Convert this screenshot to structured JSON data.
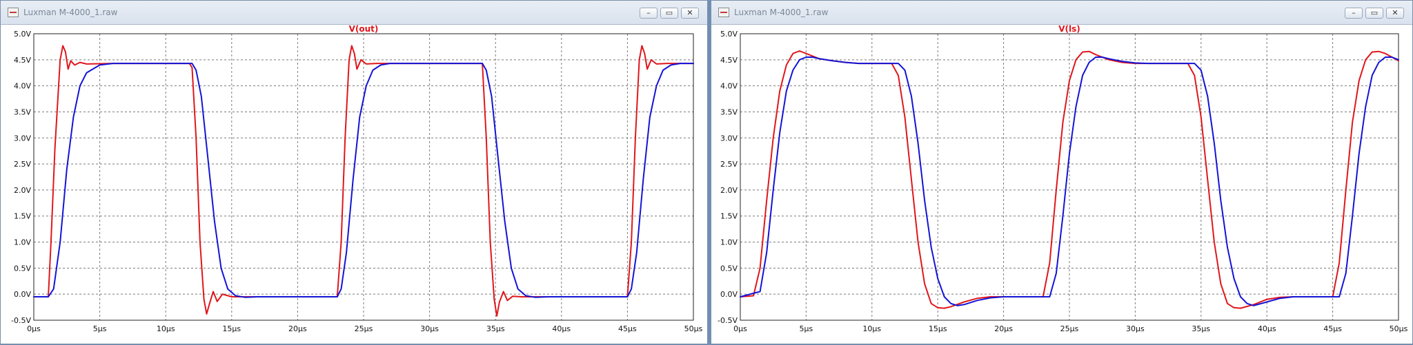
{
  "windows": [
    {
      "title": "Luxman M-4000_1.raw",
      "controls": {
        "minimize": "–",
        "restore": "▭",
        "close": "✕"
      },
      "chart_data": {
        "type": "line",
        "title": "V(out)",
        "title_color": "#e0161b",
        "xlim": [
          0,
          50
        ],
        "ylim": [
          -0.5,
          5.0
        ],
        "x_ticks": [
          "0µs",
          "5µs",
          "10µs",
          "15µs",
          "20µs",
          "25µs",
          "30µs",
          "35µs",
          "40µs",
          "45µs",
          "50µs"
        ],
        "y_ticks": [
          "5.0V",
          "4.5V",
          "4.0V",
          "3.5V",
          "3.0V",
          "2.5V",
          "2.0V",
          "1.5V",
          "1.0V",
          "0.5V",
          "0.0V",
          "-0.5V"
        ],
        "grid": true,
        "series": [
          {
            "color": "#e0161b",
            "x": [
              0,
              1.1,
              1.3,
              1.6,
              2.0,
              2.2,
              2.4,
              2.6,
              2.8,
              3.1,
              3.5,
              4.0,
              6.0,
              11.8,
              12.0,
              12.3,
              12.6,
              12.9,
              13.1,
              13.3,
              13.6,
              13.9,
              14.3,
              15.0,
              23.0,
              23.3,
              23.6,
              23.9,
              24.1,
              24.3,
              24.5,
              24.8,
              25.2,
              26.0,
              34.0,
              34.3,
              34.6,
              34.9,
              35.1,
              35.3,
              35.6,
              35.9,
              36.3,
              37.0,
              45.0,
              45.3,
              45.6,
              45.9,
              46.1,
              46.3,
              46.5,
              46.8,
              47.2,
              48.0,
              50.0
            ],
            "y": [
              -0.05,
              -0.05,
              1.0,
              2.8,
              4.5,
              4.77,
              4.65,
              4.32,
              4.48,
              4.4,
              4.45,
              4.42,
              4.43,
              4.43,
              4.35,
              3.0,
              1.0,
              -0.1,
              -0.38,
              -0.2,
              0.05,
              -0.14,
              0.0,
              -0.05,
              -0.05,
              1.0,
              3.0,
              4.5,
              4.77,
              4.62,
              4.32,
              4.5,
              4.42,
              4.43,
              4.43,
              3.0,
              1.0,
              -0.1,
              -0.42,
              -0.15,
              0.05,
              -0.12,
              -0.04,
              -0.05,
              -0.05,
              1.0,
              3.0,
              4.5,
              4.77,
              4.62,
              4.32,
              4.5,
              4.42,
              4.43,
              4.43
            ]
          },
          {
            "color": "#1313d6",
            "x": [
              0,
              1.1,
              1.5,
              2.0,
              2.5,
              3.0,
              3.5,
              4.0,
              5.0,
              6.0,
              12.0,
              12.3,
              12.7,
              13.2,
              13.7,
              14.2,
              14.7,
              15.3,
              16.0,
              17.0,
              23.0,
              23.3,
              23.7,
              24.2,
              24.7,
              25.2,
              25.7,
              26.3,
              27.0,
              28.0,
              34.0,
              34.3,
              34.7,
              35.2,
              35.7,
              36.2,
              36.7,
              37.3,
              38.0,
              39.0,
              45.0,
              45.3,
              45.7,
              46.2,
              46.7,
              47.2,
              47.7,
              48.3,
              49.0,
              50.0
            ],
            "y": [
              -0.05,
              -0.05,
              0.1,
              1.0,
              2.4,
              3.4,
              4.0,
              4.25,
              4.4,
              4.43,
              4.43,
              4.3,
              3.8,
              2.6,
              1.4,
              0.5,
              0.1,
              -0.03,
              -0.06,
              -0.05,
              -0.05,
              0.1,
              0.8,
              2.2,
              3.4,
              4.0,
              4.3,
              4.4,
              4.43,
              4.43,
              4.43,
              4.3,
              3.8,
              2.6,
              1.4,
              0.5,
              0.1,
              -0.03,
              -0.06,
              -0.05,
              -0.05,
              0.1,
              0.8,
              2.2,
              3.4,
              4.0,
              4.3,
              4.4,
              4.43,
              4.43
            ]
          }
        ]
      }
    },
    {
      "title": "Luxman M-4000_1.raw",
      "controls": {
        "minimize": "–",
        "restore": "▭",
        "close": "✕"
      },
      "chart_data": {
        "type": "line",
        "title": "V(ls)",
        "title_color": "#e0161b",
        "xlim": [
          0,
          50
        ],
        "ylim": [
          -0.5,
          5.0
        ],
        "x_ticks": [
          "0µs",
          "5µs",
          "10µs",
          "15µs",
          "20µs",
          "25µs",
          "30µs",
          "35µs",
          "40µs",
          "45µs",
          "50µs"
        ],
        "y_ticks": [
          "5.0V",
          "4.5V",
          "4.0V",
          "3.5V",
          "3.0V",
          "2.5V",
          "2.0V",
          "1.5V",
          "1.0V",
          "0.5V",
          "0.0V",
          "-0.5V"
        ],
        "grid": true,
        "series": [
          {
            "color": "#e0161b",
            "x": [
              0,
              1.0,
              1.5,
              2.0,
              2.5,
              3.0,
              3.5,
              4.0,
              4.5,
              5.0,
              6.0,
              7.0,
              8.0,
              9.0,
              11.5,
              12.0,
              12.5,
              13.0,
              13.5,
              14.0,
              14.5,
              15.0,
              15.5,
              16.0,
              17.0,
              18.0,
              19.0,
              20.0,
              23.0,
              23.5,
              24.0,
              24.5,
              25.0,
              25.5,
              26.0,
              26.5,
              27.0,
              28.0,
              29.0,
              30.0,
              31.0,
              34.0,
              34.5,
              35.0,
              35.5,
              36.0,
              36.5,
              37.0,
              37.5,
              38.0,
              39.0,
              40.0,
              41.0,
              42.0,
              45.0,
              45.5,
              46.0,
              46.5,
              47.0,
              47.5,
              48.0,
              48.5,
              49.0,
              49.5,
              50.0
            ],
            "y": [
              -0.05,
              -0.03,
              0.5,
              1.8,
              3.0,
              3.9,
              4.4,
              4.62,
              4.67,
              4.62,
              4.52,
              4.48,
              4.45,
              4.43,
              4.43,
              4.2,
              3.4,
              2.2,
              1.0,
              0.2,
              -0.18,
              -0.26,
              -0.27,
              -0.24,
              -0.15,
              -0.08,
              -0.05,
              -0.05,
              -0.05,
              0.6,
              2.0,
              3.3,
              4.1,
              4.5,
              4.65,
              4.66,
              4.6,
              4.5,
              4.45,
              4.43,
              4.43,
              4.43,
              4.2,
              3.4,
              2.2,
              1.0,
              0.2,
              -0.18,
              -0.26,
              -0.27,
              -0.2,
              -0.1,
              -0.06,
              -0.05,
              -0.05,
              0.6,
              2.0,
              3.3,
              4.1,
              4.5,
              4.65,
              4.66,
              4.62,
              4.55,
              4.48
            ]
          },
          {
            "color": "#1313d6",
            "x": [
              0,
              1.5,
              2.0,
              2.5,
              3.0,
              3.5,
              4.0,
              4.5,
              5.0,
              5.5,
              6.0,
              7.0,
              8.0,
              9.0,
              10.0,
              12.0,
              12.5,
              13.0,
              13.5,
              14.0,
              14.5,
              15.0,
              15.5,
              16.0,
              16.5,
              17.0,
              18.0,
              19.0,
              20.0,
              23.5,
              24.0,
              24.5,
              25.0,
              25.5,
              26.0,
              26.5,
              27.0,
              27.5,
              28.0,
              29.0,
              30.0,
              31.0,
              34.5,
              35.0,
              35.5,
              36.0,
              36.5,
              37.0,
              37.5,
              38.0,
              38.5,
              39.0,
              40.0,
              41.0,
              42.0,
              45.5,
              46.0,
              46.5,
              47.0,
              47.5,
              48.0,
              48.5,
              49.0,
              49.5,
              50.0
            ],
            "y": [
              -0.05,
              0.05,
              0.8,
              2.0,
              3.1,
              3.9,
              4.3,
              4.5,
              4.55,
              4.55,
              4.52,
              4.48,
              4.45,
              4.43,
              4.43,
              4.43,
              4.3,
              3.8,
              2.9,
              1.8,
              0.9,
              0.3,
              -0.05,
              -0.18,
              -0.22,
              -0.2,
              -0.12,
              -0.07,
              -0.05,
              -0.05,
              0.4,
              1.5,
              2.7,
              3.6,
              4.2,
              4.45,
              4.55,
              4.55,
              4.52,
              4.47,
              4.44,
              4.43,
              4.43,
              4.3,
              3.8,
              2.9,
              1.8,
              0.9,
              0.3,
              -0.05,
              -0.18,
              -0.22,
              -0.15,
              -0.08,
              -0.05,
              -0.05,
              0.4,
              1.5,
              2.7,
              3.6,
              4.2,
              4.45,
              4.55,
              4.55,
              4.5
            ]
          }
        ]
      }
    }
  ]
}
